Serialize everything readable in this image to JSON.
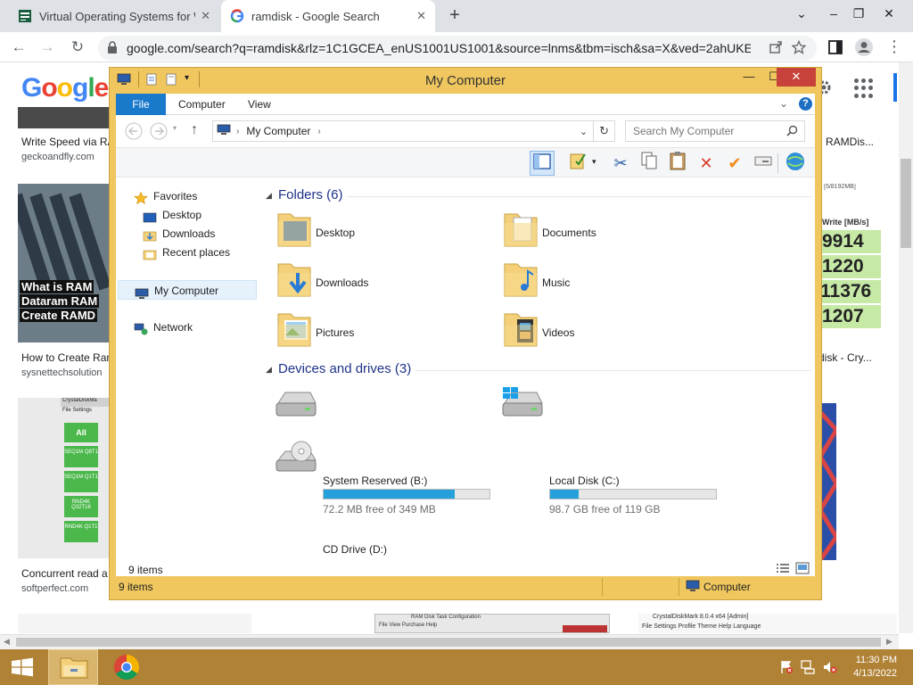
{
  "browser": {
    "tabs": [
      {
        "title": "Virtual Operating Systems for W",
        "close": "✕"
      },
      {
        "title": "ramdisk - Google Search",
        "close": "✕"
      }
    ],
    "new_tab": "+",
    "window_controls": {
      "chevron": "⌄",
      "minimize": "–",
      "restore": "❐",
      "close": "✕"
    },
    "nav": {
      "back": "←",
      "forward": "→",
      "reload": "↻"
    },
    "url": "google.com/search?q=ramdisk&rlz=1C1GCEA_enUS1001US1001&source=lnms&tbm=isch&sa=X&ved=2ahUKE..."
  },
  "google": {
    "logo": [
      "G",
      "o",
      "o",
      "g",
      "l",
      "e"
    ],
    "results": [
      {
        "caption": "Write Speed via RA",
        "source": "geckoandfly.com"
      },
      {
        "caption": "How to Create Ran",
        "source": "sysnettechsolution"
      },
      {
        "caption": "Concurrent read a",
        "source": "softperfect.com"
      },
      {
        "caption": "RAMDis...",
        "source": ""
      },
      {
        "caption": "disk - Cry...",
        "source": ""
      }
    ],
    "thumb_text": {
      "ramdisk_line1": "What is RAM",
      "ramdisk_line2": "Dataram RAM",
      "ramdisk_line3": "Create RAMD",
      "bench_header": "Write [MB/s]",
      "bench_top": "[5/8192MB]",
      "bench_values": [
        "9914",
        "1220",
        "11376",
        "1207"
      ],
      "cdm_title": "CrystalDiskMa",
      "cdm_all": "All",
      "cdm_rows": [
        "SEQ1M Q8T1",
        "SEQ1M Q1T1",
        "RND4K Q32T16",
        "RND4K Q1T1"
      ],
      "cdm_menu": "File Settings",
      "bottom_mid_title": "RAM Disk Task Configuration",
      "bottom_mid_menu": "File  View  Purchase  Help",
      "bottom_right_title": "CrystalDiskMark 8.0.4 x64 [Admin]",
      "bottom_right_menu": "File  Settings  Profile  Theme  Help  Language"
    }
  },
  "explorer": {
    "title": "My Computer",
    "controls": {
      "minimize": "—",
      "maximize": "☐",
      "close": "✕"
    },
    "ribbon_tabs": [
      "File",
      "Computer",
      "View"
    ],
    "ribbon_expand": "⌄",
    "help": "?",
    "address": {
      "icon_label": "My Computer",
      "path": "My Computer",
      "sep": "›"
    },
    "search_placeholder": "Search My Computer",
    "nav_pane": {
      "favorites": "Favorites",
      "fav_items": [
        "Desktop",
        "Downloads",
        "Recent places"
      ],
      "my_computer": "My Computer",
      "network": "Network"
    },
    "folders_header": "Folders (6)",
    "folders": [
      "Desktop",
      "Documents",
      "Downloads",
      "Music",
      "Pictures",
      "Videos"
    ],
    "drives_header": "Devices and drives (3)",
    "drives": [
      {
        "name": "System Reserved (B:)",
        "free": "72.2 MB free of 349 MB",
        "used_fraction": 0.79
      },
      {
        "name": "Local Disk (C:)",
        "free": "98.7 GB free of 119 GB",
        "used_fraction": 0.17
      },
      {
        "name": "CD Drive (D:)",
        "free": "",
        "used_fraction": 0
      }
    ],
    "status_items": "9 items",
    "outer_status_items": "9 items",
    "outer_status_location": "Computer"
  },
  "taskbar": {
    "time": "11:30 PM",
    "date": "4/13/2022"
  },
  "colors": {
    "explorer_frame": "#f0c75e",
    "file_tab": "#1979ca",
    "taskbar": "#b08236",
    "drive_fill": "#26a0da",
    "group_header": "#1e3287"
  }
}
